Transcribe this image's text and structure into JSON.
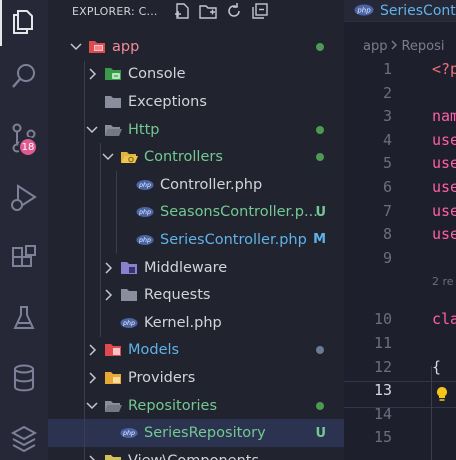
{
  "activity_bar": {
    "items": [
      {
        "name": "explorer-icon",
        "active": true
      },
      {
        "name": "search-icon",
        "active": false
      },
      {
        "name": "source-control-icon",
        "active": false,
        "badge": "18"
      },
      {
        "name": "run-debug-icon",
        "active": false
      },
      {
        "name": "extensions-icon",
        "active": false
      },
      {
        "name": "testing-icon",
        "active": false
      },
      {
        "name": "database-icon",
        "active": false
      },
      {
        "name": "layers-icon",
        "active": false
      }
    ],
    "badge_color": "#e05a92"
  },
  "sidebar": {
    "title": "EXPLORER: C...",
    "actions": [
      "new-file-icon",
      "new-folder-icon",
      "refresh-icon",
      "collapse-all-icon"
    ],
    "tree": [
      {
        "label": "app",
        "kind": "folder-open",
        "color": "#f48b9b",
        "decoration": "dot",
        "deco_color": "#4e9a55"
      },
      {
        "label": "Console",
        "kind": "folder",
        "color": "#d3d4da"
      },
      {
        "label": "Exceptions",
        "kind": "folder",
        "color": "#d3d4da"
      },
      {
        "label": "Http",
        "kind": "folder-open",
        "color": "#73c991",
        "decoration": "dot",
        "deco_color": "#4e9a55"
      },
      {
        "label": "Controllers",
        "kind": "folder-open",
        "color": "#73c991",
        "decoration": "dot",
        "deco_color": "#4e9a55"
      },
      {
        "label": "Controller.php",
        "kind": "php",
        "color": "#d3d4da"
      },
      {
        "label": "SeasonsController.p...",
        "kind": "php",
        "color": "#73c991",
        "decoration": "U",
        "deco_color": "#73c991"
      },
      {
        "label": "SeriesController.php",
        "kind": "php",
        "color": "#5fb3e8",
        "decoration": "M",
        "deco_color": "#5fb3e8"
      },
      {
        "label": "Middleware",
        "kind": "folder",
        "color": "#d3d4da"
      },
      {
        "label": "Requests",
        "kind": "folder",
        "color": "#d3d4da"
      },
      {
        "label": "Kernel.php",
        "kind": "php",
        "color": "#d3d4da"
      },
      {
        "label": "Models",
        "kind": "folder",
        "color": "#5fb3e8",
        "decoration": "dot",
        "deco_color": "#6b7a93"
      },
      {
        "label": "Providers",
        "kind": "folder",
        "color": "#d3d4da"
      },
      {
        "label": "Repositories",
        "kind": "folder-open",
        "color": "#73c991",
        "decoration": "dot",
        "deco_color": "#4e9a55"
      },
      {
        "label": "SeriesRepository",
        "kind": "php",
        "color": "#73c991",
        "decoration": "U",
        "deco_color": "#73c991",
        "selected": true
      },
      {
        "label": "View\\Components",
        "kind": "folder",
        "color": "#d3d4da"
      }
    ]
  },
  "editor": {
    "tab_label": "SeriesCont",
    "breadcrumb": [
      "app",
      "Reposi"
    ],
    "line_numbers": [
      "1",
      "2",
      "3",
      "4",
      "5",
      "6",
      "7",
      "8",
      "9",
      "10",
      "11",
      "12",
      "13",
      "14",
      "15"
    ],
    "current_line": "13",
    "code_lines": [
      {
        "line": "1",
        "text": "<?p",
        "color": "#f07178"
      },
      {
        "line": "3",
        "text": "nam",
        "color": "#ff5fa7"
      },
      {
        "line": "4",
        "text": "use",
        "color": "#ff5fa7"
      },
      {
        "line": "5",
        "text": "use",
        "color": "#ff5fa7"
      },
      {
        "line": "6",
        "text": "use",
        "color": "#ff5fa7"
      },
      {
        "line": "7",
        "text": "use",
        "color": "#ff5fa7"
      },
      {
        "line": "8",
        "text": "use",
        "color": "#ff5fa7"
      },
      {
        "line": "10",
        "text": "cla",
        "color": "#ff5fa7"
      },
      {
        "line": "12",
        "text": "{",
        "color": "#d8d9e0"
      }
    ],
    "references_hint": "2 re"
  }
}
